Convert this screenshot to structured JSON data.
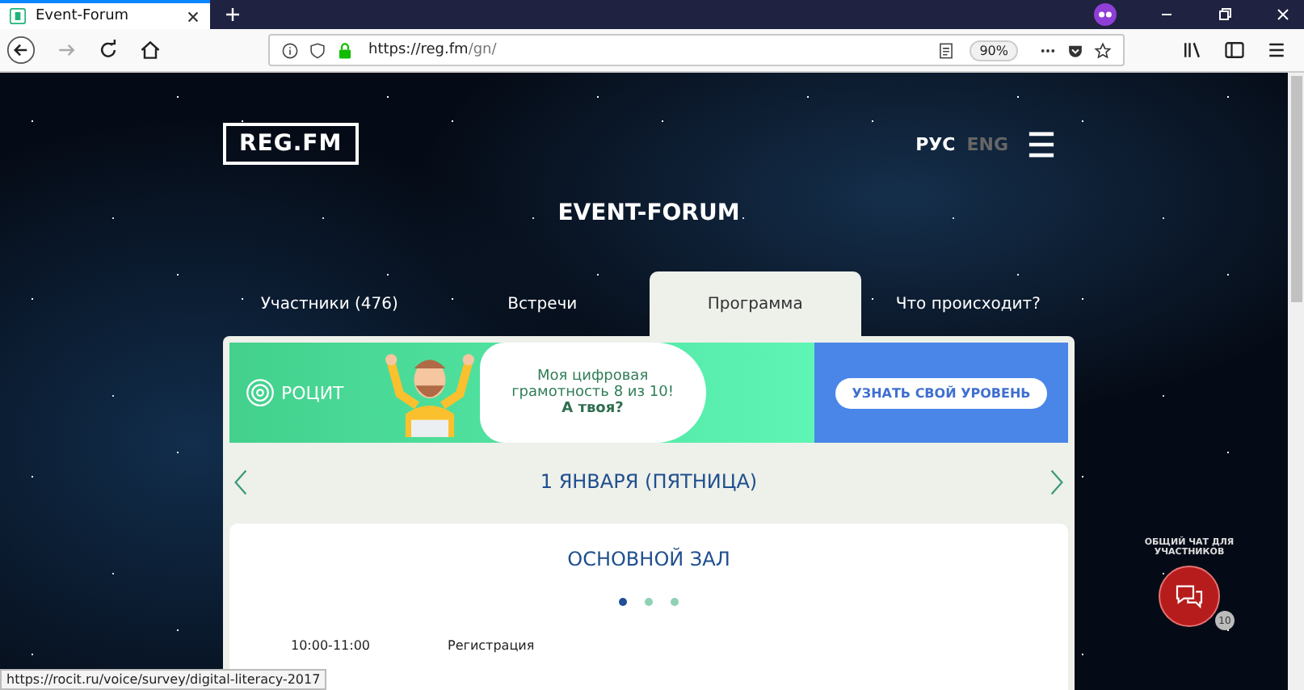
{
  "browser": {
    "tab_title": "Event-Forum",
    "url_host": "https://reg.fm",
    "url_path": "/gn/",
    "zoom": "90%"
  },
  "site": {
    "logo": "REG.FM",
    "languages": [
      {
        "label": "РУС",
        "selected": true
      },
      {
        "label": "ENG",
        "selected": false
      }
    ],
    "title": "EVENT-FORUM",
    "tabs": [
      {
        "label": "Участники (476)",
        "selected": false
      },
      {
        "label": "Встречи",
        "selected": false
      },
      {
        "label": "Программа",
        "selected": true
      },
      {
        "label": "Что происходит?",
        "selected": false
      }
    ],
    "banner": {
      "brand": "РОЦИТ",
      "text": "Моя цифровая грамотность 8 из 10!",
      "question": "А твоя?",
      "button": "УЗНАТЬ СВОЙ УРОВЕНЬ"
    },
    "date": "1 ЯНВАРЯ (ПЯТНИЦА)",
    "hall": "ОСНОВНОЙ ЗАЛ",
    "hall_dots": [
      {
        "selected": true
      },
      {
        "selected": false
      },
      {
        "selected": false
      }
    ],
    "schedule": [
      {
        "time": "10:00-11:00",
        "title": "Регистрация"
      }
    ],
    "chat": {
      "label": "ОБЩИЙ ЧАТ ДЛЯ УЧАСТНИКОВ",
      "count": "10"
    }
  },
  "status_bar": {
    "url": "https://rocit.ru/voice/survey/digital-literacy-2017"
  }
}
